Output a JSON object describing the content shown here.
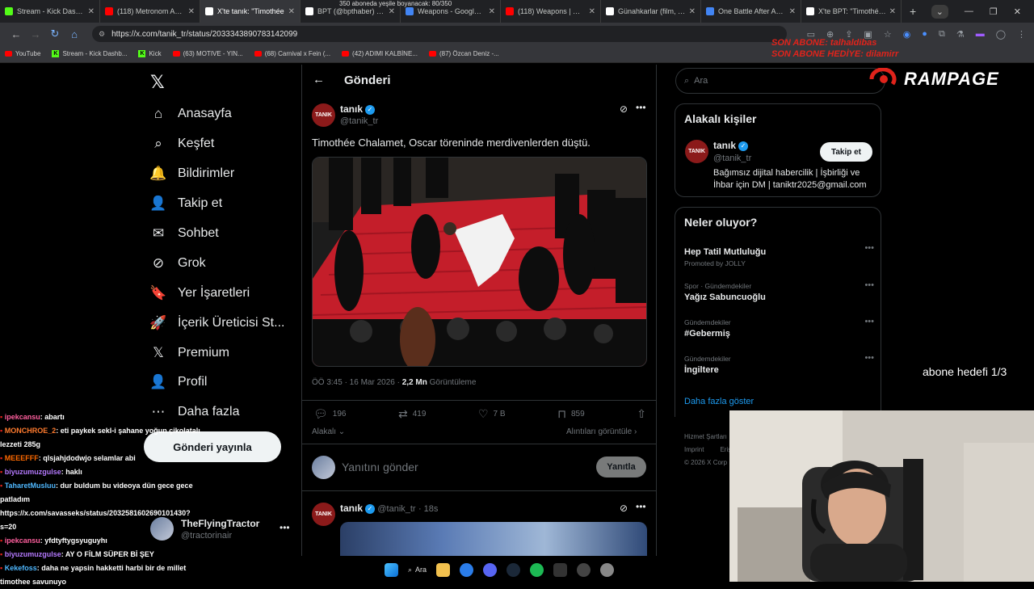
{
  "browser": {
    "tabs": [
      {
        "title": "Stream - Kick Dashbo",
        "icon": "kick-icon",
        "color": "#53fc18"
      },
      {
        "title": "(118) Metronom Akan",
        "icon": "youtube-icon",
        "color": "#ff0000"
      },
      {
        "title": "X'te tanık: \"Timothée",
        "icon": "x-icon",
        "color": "#ffffff",
        "active": true
      },
      {
        "title": "BPT (@bpthaber) / X",
        "icon": "x-icon",
        "color": "#ffffff"
      },
      {
        "title": "Weapons - Google'da A",
        "icon": "google-icon",
        "color": "#4285f4"
      },
      {
        "title": "(118) Weapons | Offic",
        "icon": "youtube-icon",
        "color": "#ff0000"
      },
      {
        "title": "Günahkarlar (film, 20",
        "icon": "wikipedia-icon",
        "color": "#ffffff"
      },
      {
        "title": "One Battle After Anot",
        "icon": "google-icon",
        "color": "#4285f4"
      },
      {
        "title": "X'te BPT: \"Timothée C",
        "icon": "x-icon",
        "color": "#ffffff"
      }
    ],
    "url": "https://x.com/tanik_tr/status/2033343890783142099",
    "bookmarks": [
      {
        "label": "YouTube",
        "icon": "youtube"
      },
      {
        "label": "Stream - Kick Dashb...",
        "icon": "kick"
      },
      {
        "label": "Kick",
        "icon": "kick"
      },
      {
        "label": "(63) MOTIVE - YIN...",
        "icon": "youtube"
      },
      {
        "label": "(68) Carnival x Fein (...",
        "icon": "youtube"
      },
      {
        "label": "(42) ADIMI KALBİNE...",
        "icon": "youtube"
      },
      {
        "label": "(87) Özcan Deniz -...",
        "icon": "youtube"
      }
    ]
  },
  "overlay": {
    "top_note": "350 aboneda yeşile boyanacak: 80/350",
    "sub_line1": "SON ABONE: talhaldibas",
    "sub_line2": "SON ABONE HEDİYE: dilamirr",
    "brand": "RAMPAGE",
    "goal": "abone hedefi 1/3"
  },
  "nav": {
    "items": [
      {
        "label": "Anasayfa",
        "icon": "home-icon",
        "glyph": "⌂"
      },
      {
        "label": "Keşfet",
        "icon": "search-icon",
        "glyph": "⌕"
      },
      {
        "label": "Bildirimler",
        "icon": "bell-icon",
        "glyph": "🔔"
      },
      {
        "label": "Takip et",
        "icon": "follow-icon",
        "glyph": "👤"
      },
      {
        "label": "Sohbet",
        "icon": "mail-icon",
        "glyph": "✉"
      },
      {
        "label": "Grok",
        "icon": "grok-icon",
        "glyph": "⊘"
      },
      {
        "label": "Yer İşaretleri",
        "icon": "bookmark-icon",
        "glyph": "🔖"
      },
      {
        "label": "İçerik Üreticisi St...",
        "icon": "rocket-icon",
        "glyph": "🚀"
      },
      {
        "label": "Premium",
        "icon": "x-premium-icon",
        "glyph": "𝕏"
      },
      {
        "label": "Profil",
        "icon": "profile-icon",
        "glyph": "👤"
      },
      {
        "label": "Daha fazla",
        "icon": "more-icon",
        "glyph": "⋯"
      }
    ],
    "post_button": "Gönderi yayınla",
    "account_name": "TheFlyingTractor",
    "account_handle": "@tractorinair"
  },
  "post": {
    "header": "Gönderi",
    "author": "tanık",
    "handle": "@tanik_tr",
    "avatar_text": "TANIK",
    "text": "Timothée Chalamet, Oscar töreninde merdivenlerden düştü.",
    "time": "ÖÖ 3:45 · 16 Mar 2026 · ",
    "views": "2,2 Mn",
    "views_label": "Görüntüleme",
    "replies": "196",
    "reposts": "419",
    "likes": "7 B",
    "bookmarks": "859",
    "sort": "Alakalı",
    "quotes": "Alıntıları görüntüle",
    "reply_placeholder": "Yanıtını gönder",
    "reply_button": "Yanıtla"
  },
  "reply_tweet": {
    "author": "tanık",
    "handle": "@tanik_tr",
    "time": "· 18s",
    "avatar_text": "TANIK"
  },
  "right": {
    "search_placeholder": "Ara",
    "related_title": "Alakalı kişiler",
    "related_name": "tanık",
    "related_handle": "@tanik_tr",
    "related_bio": "Bağımsız dijital habercilik | İşbirliği ve İhbar için DM | taniktr2025@gmail.com",
    "follow": "Takip et",
    "trends_title": "Neler oluyor?",
    "trends": [
      {
        "cat": "",
        "name": "Hep Tatil Mutluluğu",
        "sub": "Promoted by JOLLY"
      },
      {
        "cat": "Spor · Gündemdekiler",
        "name": "Yağız Sabuncuoğlu",
        "sub": ""
      },
      {
        "cat": "Gündemdekiler",
        "name": "#Gebermiş",
        "sub": ""
      },
      {
        "cat": "Gündemdekiler",
        "name": "İngiltere",
        "sub": ""
      }
    ],
    "show_more": "Daha fazla göster",
    "footer1": "Hizmet Şartları",
    "footer2": "Imprint",
    "footer3": "Erişi",
    "footer4": "© 2026 X Corp"
  },
  "chat": [
    {
      "user": "ipekcansu",
      "color": "#ff5f9e",
      "msg": ": abartı"
    },
    {
      "user": "MONCHROE_2",
      "color": "#ff7b2e",
      "msg": ": eti paykek sekl-i şahane yoğun çikolatalı"
    },
    {
      "user": "",
      "color": "#ffffff",
      "msg": "lezzeti 285g"
    },
    {
      "user": "MEEEFFF",
      "color": "#ff6a00",
      "msg": ": qlsjahjdodwjo selamlar abi"
    },
    {
      "user": "biyuzumuzgulse",
      "color": "#b57aff",
      "msg": ": haklı"
    },
    {
      "user": "TaharetMusluu",
      "color": "#4fb8ff",
      "msg": ": dur buldum bu videoya dün gece gece"
    },
    {
      "user": "",
      "color": "#ffffff",
      "msg": "patladım"
    },
    {
      "user": "",
      "color": "#ffffff",
      "msg": "https://x.com/savasseks/status/2032581602690101430?"
    },
    {
      "user": "",
      "color": "#ffffff",
      "msg": "s=20"
    },
    {
      "user": "ipekcansu",
      "color": "#ff5f9e",
      "msg": ": yfdtyftygsyuguyhı"
    },
    {
      "user": "biyuzumuzgulse",
      "color": "#b57aff",
      "msg": ": AY O FİLM SÜPER Bİ ŞEY"
    },
    {
      "user": "Kekefoss",
      "color": "#4fb8ff",
      "msg": ": daha ne yapsin hakketti harbi bir de millet"
    },
    {
      "user": "",
      "color": "#ffffff",
      "msg": "timothee savunuyo"
    }
  ],
  "taskbar": {
    "search": "Ara"
  }
}
